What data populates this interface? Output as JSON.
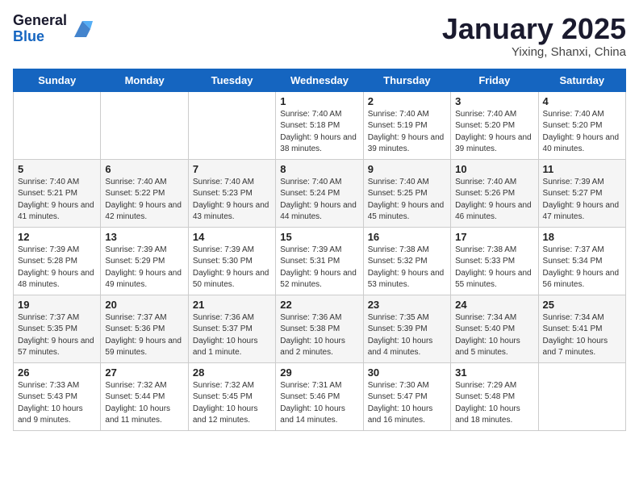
{
  "header": {
    "logo_line1": "General",
    "logo_line2": "Blue",
    "month": "January 2025",
    "location": "Yixing, Shanxi, China"
  },
  "days_of_week": [
    "Sunday",
    "Monday",
    "Tuesday",
    "Wednesday",
    "Thursday",
    "Friday",
    "Saturday"
  ],
  "weeks": [
    [
      {
        "day": "",
        "info": ""
      },
      {
        "day": "",
        "info": ""
      },
      {
        "day": "",
        "info": ""
      },
      {
        "day": "1",
        "info": "Sunrise: 7:40 AM\nSunset: 5:18 PM\nDaylight: 9 hours\nand 38 minutes."
      },
      {
        "day": "2",
        "info": "Sunrise: 7:40 AM\nSunset: 5:19 PM\nDaylight: 9 hours\nand 39 minutes."
      },
      {
        "day": "3",
        "info": "Sunrise: 7:40 AM\nSunset: 5:20 PM\nDaylight: 9 hours\nand 39 minutes."
      },
      {
        "day": "4",
        "info": "Sunrise: 7:40 AM\nSunset: 5:20 PM\nDaylight: 9 hours\nand 40 minutes."
      }
    ],
    [
      {
        "day": "5",
        "info": "Sunrise: 7:40 AM\nSunset: 5:21 PM\nDaylight: 9 hours\nand 41 minutes."
      },
      {
        "day": "6",
        "info": "Sunrise: 7:40 AM\nSunset: 5:22 PM\nDaylight: 9 hours\nand 42 minutes."
      },
      {
        "day": "7",
        "info": "Sunrise: 7:40 AM\nSunset: 5:23 PM\nDaylight: 9 hours\nand 43 minutes."
      },
      {
        "day": "8",
        "info": "Sunrise: 7:40 AM\nSunset: 5:24 PM\nDaylight: 9 hours\nand 44 minutes."
      },
      {
        "day": "9",
        "info": "Sunrise: 7:40 AM\nSunset: 5:25 PM\nDaylight: 9 hours\nand 45 minutes."
      },
      {
        "day": "10",
        "info": "Sunrise: 7:40 AM\nSunset: 5:26 PM\nDaylight: 9 hours\nand 46 minutes."
      },
      {
        "day": "11",
        "info": "Sunrise: 7:39 AM\nSunset: 5:27 PM\nDaylight: 9 hours\nand 47 minutes."
      }
    ],
    [
      {
        "day": "12",
        "info": "Sunrise: 7:39 AM\nSunset: 5:28 PM\nDaylight: 9 hours\nand 48 minutes."
      },
      {
        "day": "13",
        "info": "Sunrise: 7:39 AM\nSunset: 5:29 PM\nDaylight: 9 hours\nand 49 minutes."
      },
      {
        "day": "14",
        "info": "Sunrise: 7:39 AM\nSunset: 5:30 PM\nDaylight: 9 hours\nand 50 minutes."
      },
      {
        "day": "15",
        "info": "Sunrise: 7:39 AM\nSunset: 5:31 PM\nDaylight: 9 hours\nand 52 minutes."
      },
      {
        "day": "16",
        "info": "Sunrise: 7:38 AM\nSunset: 5:32 PM\nDaylight: 9 hours\nand 53 minutes."
      },
      {
        "day": "17",
        "info": "Sunrise: 7:38 AM\nSunset: 5:33 PM\nDaylight: 9 hours\nand 55 minutes."
      },
      {
        "day": "18",
        "info": "Sunrise: 7:37 AM\nSunset: 5:34 PM\nDaylight: 9 hours\nand 56 minutes."
      }
    ],
    [
      {
        "day": "19",
        "info": "Sunrise: 7:37 AM\nSunset: 5:35 PM\nDaylight: 9 hours\nand 57 minutes."
      },
      {
        "day": "20",
        "info": "Sunrise: 7:37 AM\nSunset: 5:36 PM\nDaylight: 9 hours\nand 59 minutes."
      },
      {
        "day": "21",
        "info": "Sunrise: 7:36 AM\nSunset: 5:37 PM\nDaylight: 10 hours\nand 1 minute."
      },
      {
        "day": "22",
        "info": "Sunrise: 7:36 AM\nSunset: 5:38 PM\nDaylight: 10 hours\nand 2 minutes."
      },
      {
        "day": "23",
        "info": "Sunrise: 7:35 AM\nSunset: 5:39 PM\nDaylight: 10 hours\nand 4 minutes."
      },
      {
        "day": "24",
        "info": "Sunrise: 7:34 AM\nSunset: 5:40 PM\nDaylight: 10 hours\nand 5 minutes."
      },
      {
        "day": "25",
        "info": "Sunrise: 7:34 AM\nSunset: 5:41 PM\nDaylight: 10 hours\nand 7 minutes."
      }
    ],
    [
      {
        "day": "26",
        "info": "Sunrise: 7:33 AM\nSunset: 5:43 PM\nDaylight: 10 hours\nand 9 minutes."
      },
      {
        "day": "27",
        "info": "Sunrise: 7:32 AM\nSunset: 5:44 PM\nDaylight: 10 hours\nand 11 minutes."
      },
      {
        "day": "28",
        "info": "Sunrise: 7:32 AM\nSunset: 5:45 PM\nDaylight: 10 hours\nand 12 minutes."
      },
      {
        "day": "29",
        "info": "Sunrise: 7:31 AM\nSunset: 5:46 PM\nDaylight: 10 hours\nand 14 minutes."
      },
      {
        "day": "30",
        "info": "Sunrise: 7:30 AM\nSunset: 5:47 PM\nDaylight: 10 hours\nand 16 minutes."
      },
      {
        "day": "31",
        "info": "Sunrise: 7:29 AM\nSunset: 5:48 PM\nDaylight: 10 hours\nand 18 minutes."
      },
      {
        "day": "",
        "info": ""
      }
    ]
  ]
}
